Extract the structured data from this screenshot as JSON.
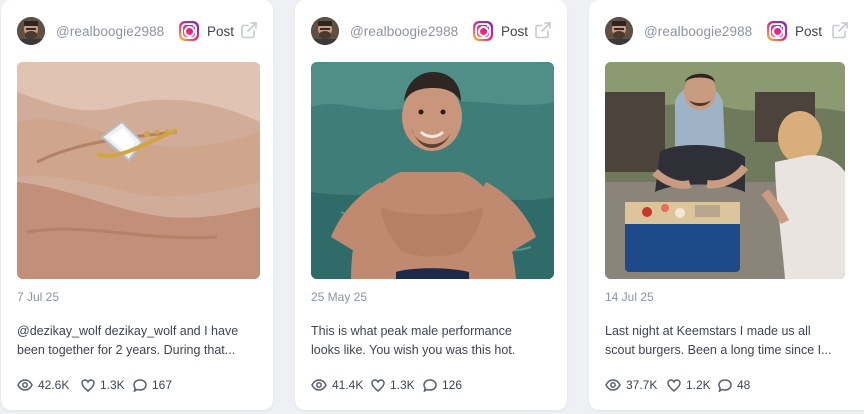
{
  "post_type_label": "Post",
  "icons": {
    "views": "eye-icon",
    "likes": "heart-icon",
    "comments": "comment-icon",
    "platform": "instagram-icon",
    "open": "external-link-icon"
  },
  "colors": {
    "muted_text": "#8d93a2",
    "body_text": "#3e4452",
    "card_bg": "#ffffff",
    "page_bg": "#eef0f3"
  },
  "cards": [
    {
      "handle": "@realboogie2988",
      "date": "7 Jul 25",
      "caption_line1": "@dezikay_wolf dezikay_wolf and I have",
      "caption_line2": "been together for 2 years. During that...",
      "views": "42.6K",
      "likes": "1.3K",
      "comments": "167"
    },
    {
      "handle": "@realboogie2988",
      "date": "25 May 25",
      "caption_line1": "This is what peak male performance",
      "caption_line2": "looks like. You wish you was this hot.",
      "views": "41.4K",
      "likes": "1.3K",
      "comments": "126"
    },
    {
      "handle": "@realboogie2988",
      "date": "14 Jul 25",
      "caption_line1": "Last night at Keemstars I made us all",
      "caption_line2": "scout burgers. Been a long time since I...",
      "views": "37.7K",
      "likes": "1.2K",
      "comments": "48"
    }
  ]
}
